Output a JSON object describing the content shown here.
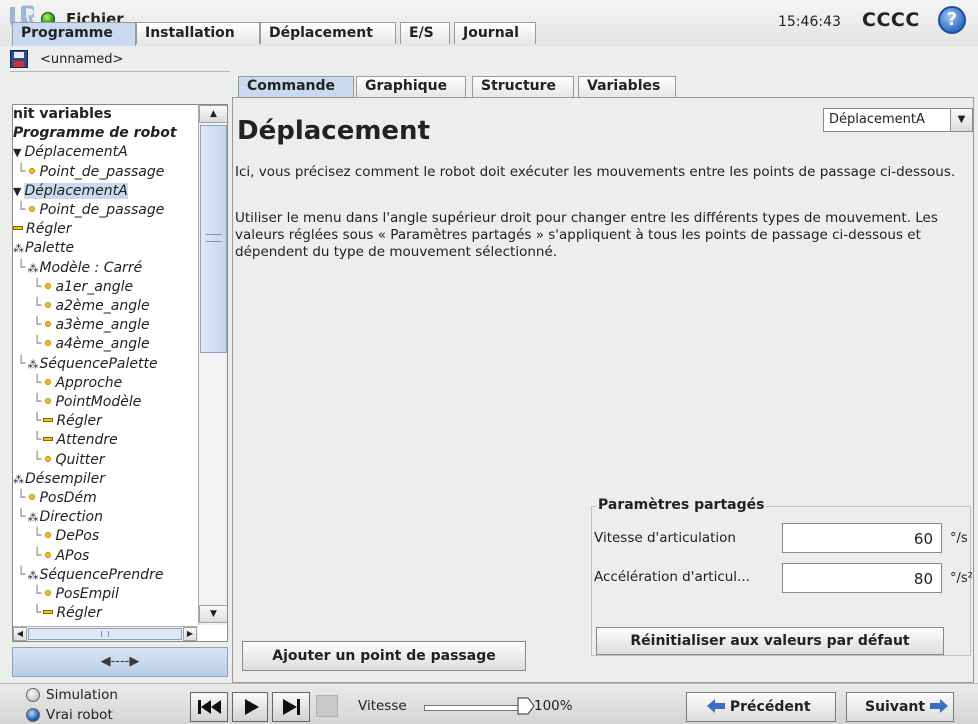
{
  "header": {
    "file_menu": "Fichier",
    "clock": "15:46:43",
    "robot_name": "CCCC",
    "help_label": "?"
  },
  "main_tabs": [
    {
      "label": "Programme",
      "active": true
    },
    {
      "label": "Installation",
      "active": false
    },
    {
      "label": "Déplacement",
      "active": false
    },
    {
      "label": "E/S",
      "active": false
    },
    {
      "label": "Journal",
      "active": false
    }
  ],
  "program": {
    "name": "<unnamed>"
  },
  "tree": [
    {
      "label": "nit variables",
      "style": "plain",
      "indent": 0,
      "icon": "none"
    },
    {
      "label": "Programme de robot",
      "style": "bold-it",
      "indent": 0,
      "icon": "none"
    },
    {
      "label": "DéplacementA",
      "style": "it",
      "indent": 0,
      "icon": "tri"
    },
    {
      "label": "Point_de_passage",
      "style": "it",
      "indent": 1,
      "icon": "dot"
    },
    {
      "label": "DéplacementA",
      "style": "it",
      "indent": 0,
      "icon": "tri",
      "selected": true
    },
    {
      "label": "Point_de_passage",
      "style": "it",
      "indent": 1,
      "icon": "dot"
    },
    {
      "label": "Régler",
      "style": "it",
      "indent": 0,
      "icon": "bar"
    },
    {
      "label": "Palette",
      "style": "it",
      "indent": 0,
      "icon": "mol"
    },
    {
      "label": "Modèle : Carré",
      "style": "it",
      "indent": 1,
      "icon": "mol"
    },
    {
      "label": "a1er_angle",
      "style": "it",
      "indent": 2,
      "icon": "dot"
    },
    {
      "label": "a2ème_angle",
      "style": "it",
      "indent": 2,
      "icon": "dot"
    },
    {
      "label": "a3ème_angle",
      "style": "it",
      "indent": 2,
      "icon": "dot"
    },
    {
      "label": "a4ème_angle",
      "style": "it",
      "indent": 2,
      "icon": "dot"
    },
    {
      "label": "SéquencePalette",
      "style": "it",
      "indent": 1,
      "icon": "mol"
    },
    {
      "label": "Approche",
      "style": "it",
      "indent": 2,
      "icon": "dot"
    },
    {
      "label": "PointModèle",
      "style": "it",
      "indent": 2,
      "icon": "dot"
    },
    {
      "label": "Régler",
      "style": "it",
      "indent": 2,
      "icon": "bar"
    },
    {
      "label": "Attendre",
      "style": "it",
      "indent": 2,
      "icon": "bar"
    },
    {
      "label": "Quitter",
      "style": "it",
      "indent": 2,
      "icon": "dot"
    },
    {
      "label": "Désempiler",
      "style": "it",
      "indent": 0,
      "icon": "mol"
    },
    {
      "label": "PosDém",
      "style": "it",
      "indent": 1,
      "icon": "dot"
    },
    {
      "label": "Direction",
      "style": "it",
      "indent": 1,
      "icon": "mol"
    },
    {
      "label": "DePos",
      "style": "it",
      "indent": 2,
      "icon": "dot"
    },
    {
      "label": "APos",
      "style": "it",
      "indent": 2,
      "icon": "dot"
    },
    {
      "label": "SéquencePrendre",
      "style": "it",
      "indent": 1,
      "icon": "mol"
    },
    {
      "label": "PosEmpil",
      "style": "it",
      "indent": 2,
      "icon": "dot"
    },
    {
      "label": "Régler",
      "style": "it",
      "indent": 2,
      "icon": "bar"
    }
  ],
  "expand_label": "◀----▶",
  "sub_tabs": [
    {
      "label": "Commande",
      "active": true
    },
    {
      "label": "Graphique",
      "active": false
    },
    {
      "label": "Structure",
      "active": false
    },
    {
      "label": "Variables",
      "active": false
    }
  ],
  "content": {
    "heading": "Déplacement",
    "move_type": "DéplacementA",
    "para1": "Ici, vous précisez comment le robot doit exécuter les mouvements entre les points de passage ci-dessous.",
    "para2": "Utiliser le menu dans l'angle supérieur droit pour changer entre les différents types de mouvement. Les valeurs réglées sous « Paramètres partagés » s'appliquent à tous les points de passage ci-dessous et dépendent du type de mouvement sélectionné.",
    "shared": {
      "title": "Paramètres partagés",
      "speed_label": "Vitesse d'articulation",
      "speed_value": "60",
      "speed_unit": "°/s",
      "accel_label": "Accélération d'articul...",
      "accel_value": "80",
      "accel_unit": "°/s²",
      "reset_label": "Réinitialiser aux valeurs par défaut"
    },
    "add_waypoint_label": "Ajouter un point de passage"
  },
  "bottom": {
    "mode_simulation": "Simulation",
    "mode_real": "Vrai robot",
    "speed_label": "Vitesse",
    "speed_value": "100%",
    "speed_fraction": 1.0,
    "prev_label": "Précédent",
    "next_label": "Suivant"
  },
  "colors": {
    "accent_blue": "#c9daf0",
    "status_green": "#2f9a18",
    "nav_arrow_blue": "#3d6fc0"
  }
}
